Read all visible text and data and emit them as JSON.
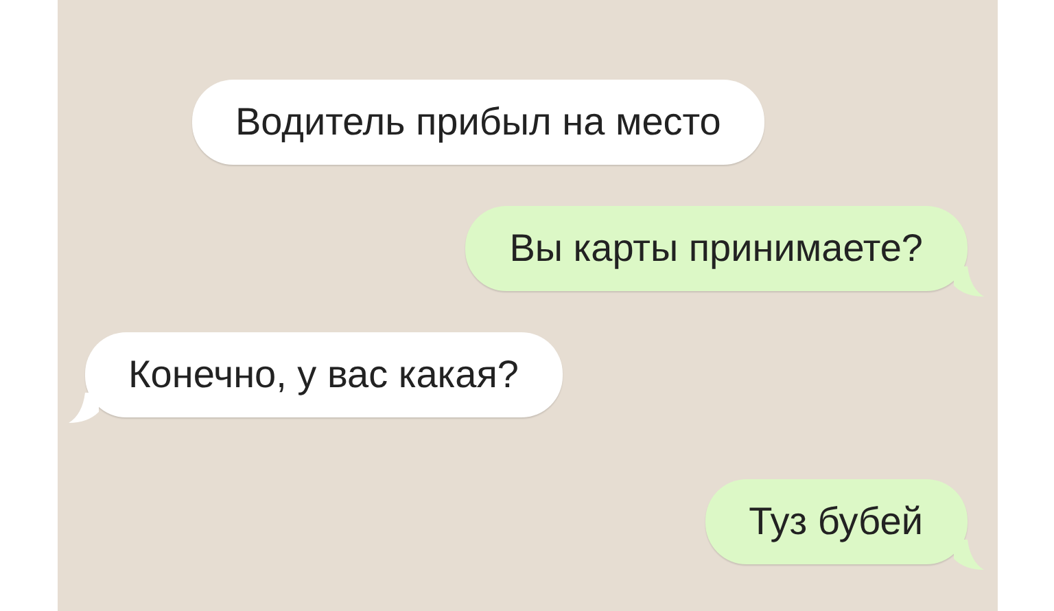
{
  "messages": [
    {
      "text": "Водитель прибыл на место",
      "kind": "incoming",
      "tail": false
    },
    {
      "text": "Вы карты принимаете?",
      "kind": "outgoing",
      "tail": true
    },
    {
      "text": "Конечно, у вас какая?",
      "kind": "incoming",
      "tail": true
    },
    {
      "text": "Туз бубей",
      "kind": "outgoing",
      "tail": true
    }
  ]
}
